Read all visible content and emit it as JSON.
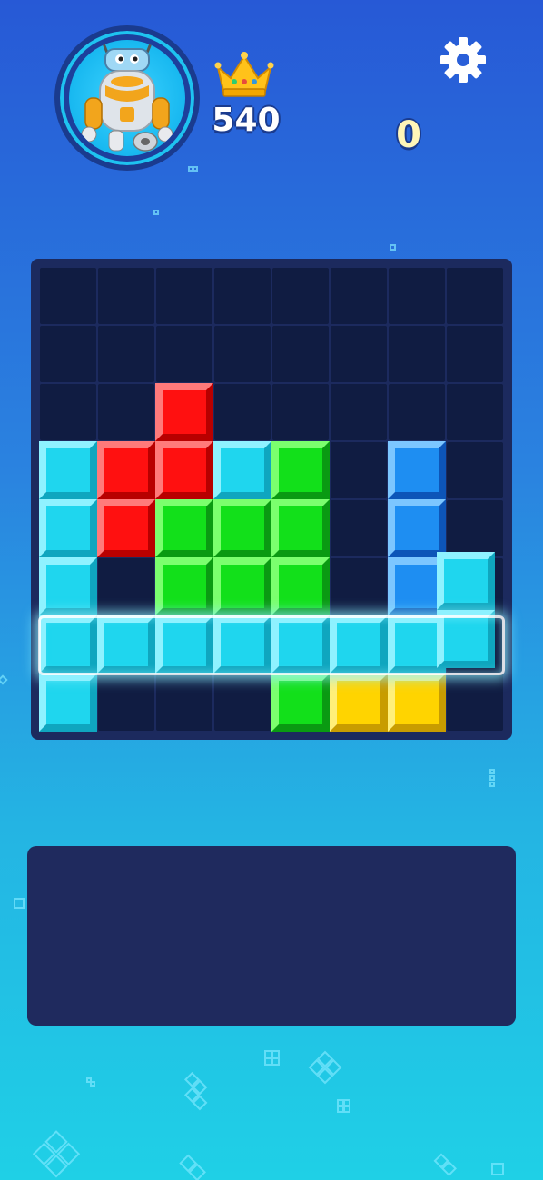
{
  "header": {
    "best_score": "540",
    "current_score": "0",
    "icons": {
      "avatar": "robot-avatar-icon",
      "crown": "crown-icon",
      "settings": "gear-icon"
    }
  },
  "board": {
    "rows": 8,
    "cols": 8,
    "colors": {
      "cyan": [
        "#1fd6ee",
        "#8ff2ff",
        "#0fa6bf"
      ],
      "red": [
        "#ff1010",
        "#ff7a7a",
        "#b80000"
      ],
      "green": [
        "#12e01a",
        "#7bff6e",
        "#0a9a12"
      ],
      "blue": [
        "#1e8ef2",
        "#7cc6ff",
        "#0d55b8"
      ],
      "yellow": [
        "#ffd400",
        "#ffef7a",
        "#c89c00"
      ]
    },
    "placed": [
      {
        "r": 2,
        "c": 2,
        "color": "red"
      },
      {
        "r": 3,
        "c": 0,
        "color": "cyan"
      },
      {
        "r": 3,
        "c": 1,
        "color": "red"
      },
      {
        "r": 3,
        "c": 2,
        "color": "red"
      },
      {
        "r": 3,
        "c": 3,
        "color": "cyan"
      },
      {
        "r": 3,
        "c": 4,
        "color": "green"
      },
      {
        "r": 3,
        "c": 6,
        "color": "blue"
      },
      {
        "r": 4,
        "c": 0,
        "color": "cyan"
      },
      {
        "r": 4,
        "c": 1,
        "color": "red"
      },
      {
        "r": 4,
        "c": 2,
        "color": "green"
      },
      {
        "r": 4,
        "c": 3,
        "color": "green"
      },
      {
        "r": 4,
        "c": 4,
        "color": "green"
      },
      {
        "r": 4,
        "c": 6,
        "color": "blue"
      },
      {
        "r": 5,
        "c": 0,
        "color": "cyan"
      },
      {
        "r": 5,
        "c": 2,
        "color": "green"
      },
      {
        "r": 5,
        "c": 3,
        "color": "green"
      },
      {
        "r": 5,
        "c": 4,
        "color": "green"
      },
      {
        "r": 5,
        "c": 6,
        "color": "blue"
      },
      {
        "r": 6,
        "c": 0,
        "color": "cyan"
      },
      {
        "r": 6,
        "c": 1,
        "color": "cyan"
      },
      {
        "r": 6,
        "c": 2,
        "color": "cyan"
      },
      {
        "r": 6,
        "c": 3,
        "color": "cyan"
      },
      {
        "r": 6,
        "c": 4,
        "color": "cyan"
      },
      {
        "r": 6,
        "c": 5,
        "color": "cyan"
      },
      {
        "r": 6,
        "c": 6,
        "color": "cyan"
      },
      {
        "r": 7,
        "c": 0,
        "color": "cyan"
      },
      {
        "r": 7,
        "c": 4,
        "color": "green"
      },
      {
        "r": 7,
        "c": 5,
        "color": "yellow"
      },
      {
        "r": 7,
        "c": 6,
        "color": "yellow"
      }
    ],
    "dragging_piece": {
      "color": "cyan",
      "cells": [
        [
          5,
          7
        ],
        [
          6,
          7
        ]
      ]
    },
    "highlighted_row": 6
  },
  "tray": {
    "pieces": []
  }
}
